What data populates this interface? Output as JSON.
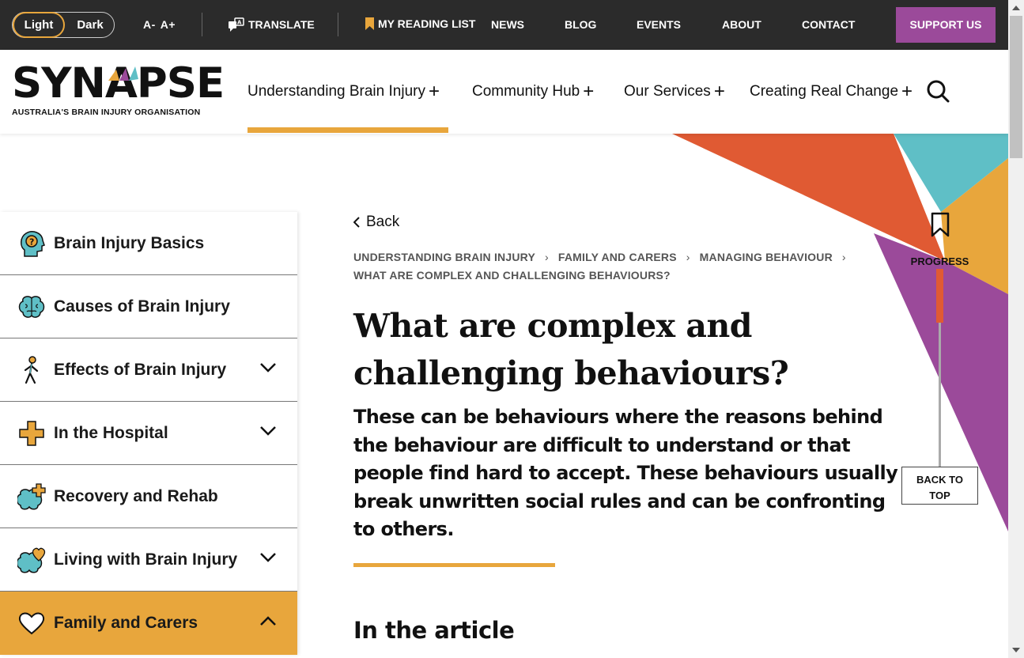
{
  "topbar": {
    "theme_light": "Light",
    "theme_dark": "Dark",
    "font_decrease": "A-",
    "font_increase": "A+",
    "translate": "TRANSLATE",
    "reading_list": "MY READING LIST",
    "links": [
      "NEWS",
      "BLOG",
      "EVENTS",
      "ABOUT",
      "CONTACT"
    ],
    "support": "SUPPORT US"
  },
  "logo": {
    "word": "SYNAPSE",
    "tagline": "AUSTRALIA'S BRAIN INJURY ORGANISATION"
  },
  "mainnav": [
    "Understanding Brain Injury",
    "Community Hub",
    "Our Services",
    "Creating Real Change"
  ],
  "sidebar": {
    "items": [
      {
        "label": "Brain Injury Basics",
        "icon": "head-question-icon"
      },
      {
        "label": "Causes of Brain Injury",
        "icon": "brain-icon"
      },
      {
        "label": "Effects of Brain Injury",
        "icon": "person-walking-icon"
      },
      {
        "label": "In the Hospital",
        "icon": "medical-cross-icon"
      },
      {
        "label": "Recovery and Rehab",
        "icon": "brain-plus-icon"
      },
      {
        "label": "Living with Brain Injury",
        "icon": "brain-heart-icon"
      },
      {
        "label": "Family and Carers",
        "icon": "heart-icon"
      }
    ]
  },
  "content": {
    "back": "Back",
    "breadcrumb": [
      "UNDERSTANDING BRAIN INJURY",
      "FAMILY AND CARERS",
      "MANAGING BEHAVIOUR",
      "WHAT ARE COMPLEX AND CHALLENGING BEHAVIOURS?"
    ],
    "title_line1": "What are complex and",
    "title_line2": "challenging behaviours?",
    "lead": "These can be behaviours where the reasons behind the behaviour are difficult to understand or that people find hard to accept. These behaviours usually break unwritten social rules and can be confronting to others.",
    "article_heading": "In the article"
  },
  "progress": {
    "label": "PROGRESS",
    "back_to_top_1": "BACK TO",
    "back_to_top_2": "TOP",
    "value": 0.27
  },
  "colors": {
    "accent": "#e8a63c",
    "support": "#9b4a9a",
    "orange": "#e05a33",
    "teal": "#5fbfc6",
    "purple": "#9b4a9a"
  }
}
